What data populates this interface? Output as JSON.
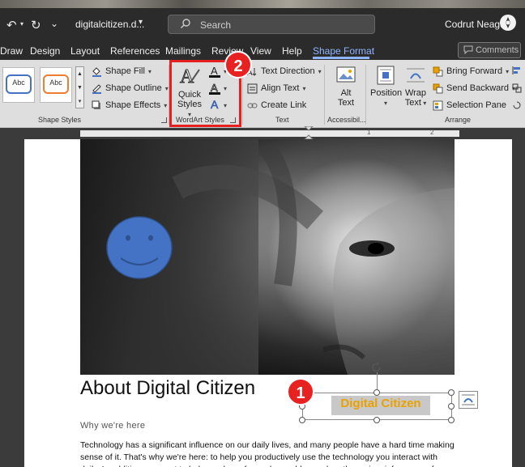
{
  "titlebar": {
    "doc_title": "digitalcitizen.d...",
    "search_placeholder": "Search",
    "user_name": "Codrut Neagu"
  },
  "tabs": [
    "Draw",
    "Design",
    "Layout",
    "References",
    "Mailings",
    "Review",
    "View",
    "Help",
    "Shape Format"
  ],
  "active_tab": "Shape Format",
  "comments_label": "Comments",
  "ribbon": {
    "shape_styles": {
      "swatch_label": "Abc",
      "shape_fill": "Shape Fill",
      "shape_outline": "Shape Outline",
      "shape_effects": "Shape Effects",
      "group_label": "Shape Styles"
    },
    "wordart": {
      "quick_styles_line1": "Quick",
      "quick_styles_line2": "Styles",
      "group_label": "WordArt Styles"
    },
    "text": {
      "text_direction": "Text Direction",
      "align_text": "Align Text",
      "create_link": "Create Link",
      "group_label": "Text"
    },
    "accessibility": {
      "alt_text_line1": "Alt",
      "alt_text_line2": "Text",
      "group_label": "Accessibil..."
    },
    "arrange": {
      "position": "Position",
      "wrap_text_line1": "Wrap",
      "wrap_text_line2": "Text",
      "bring_forward": "Bring Forward",
      "send_backward": "Send Backward",
      "selection_pane": "Selection Pane",
      "group_label": "Arrange"
    }
  },
  "badges": {
    "one": "1",
    "two": "2"
  },
  "ruler_numbers": [
    "1",
    "2"
  ],
  "document": {
    "heading": "About Digital Citizen",
    "textbox_text": "Digital Citizen",
    "subheading": "Why we're here",
    "paragraph": "Technology has a significant influence on our daily lives, and many people have a hard time making sense of it. That's why we're here: to help you productively use the technology you interact with daily. In addition, we want to help you have fun, solve problems when they arise, inform you of what's new, and"
  },
  "colors": {
    "accent_tab": "#8fb4ff",
    "highlight_red": "#e52020",
    "wordart_orange": "#e8a100",
    "smiley_blue": "#4472c4"
  }
}
